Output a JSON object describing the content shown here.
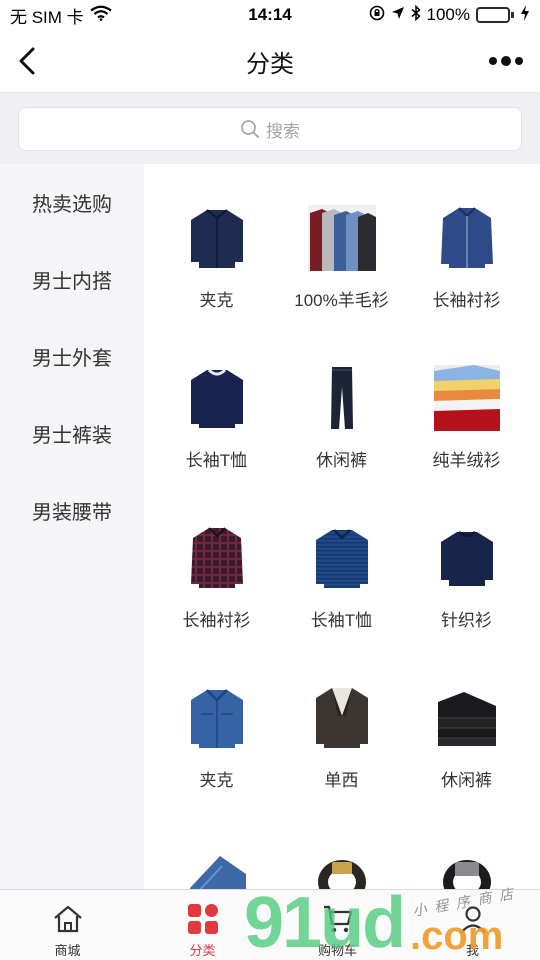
{
  "status_bar": {
    "carrier": "无 SIM 卡",
    "time": "14:14",
    "battery_percent": "100%",
    "battery_level": 1.0,
    "icons": [
      "wifi-icon",
      "orientation-lock-icon",
      "location-icon",
      "bluetooth-icon",
      "battery-icon",
      "charging-icon"
    ]
  },
  "navbar": {
    "title": "分类",
    "back_icon": "chevron-left-icon",
    "more_icon": "more-dots-icon"
  },
  "search": {
    "placeholder": "搜索",
    "icon": "search-icon"
  },
  "sidebar": {
    "items": [
      {
        "label": "热卖选购"
      },
      {
        "label": "男士内搭"
      },
      {
        "label": "男士外套"
      },
      {
        "label": "男士裤装"
      },
      {
        "label": "男装腰带"
      }
    ]
  },
  "products": [
    {
      "label": "夹克",
      "icon": "navy-jacket-image"
    },
    {
      "label": "100%羊毛衫",
      "icon": "wool-sweaters-image"
    },
    {
      "label": "长袖衬衫",
      "icon": "blue-shirt-image"
    },
    {
      "label": "长袖T恤",
      "icon": "navy-longsleeve-tee-image"
    },
    {
      "label": "休闲裤",
      "icon": "navy-trousers-image"
    },
    {
      "label": "纯羊绒衫",
      "icon": "cashmere-stack-image"
    },
    {
      "label": "长袖衬衫",
      "icon": "plaid-shirt-image"
    },
    {
      "label": "长袖T恤",
      "icon": "striped-tee-image"
    },
    {
      "label": "针织衫",
      "icon": "knit-sweater-image"
    },
    {
      "label": "夹克",
      "icon": "denim-jacket-image"
    },
    {
      "label": "单西",
      "icon": "blazer-image"
    },
    {
      "label": "休闲裤",
      "icon": "folded-trousers-image"
    }
  ],
  "tabbar": {
    "items": [
      {
        "label": "商城",
        "icon": "home-icon"
      },
      {
        "label": "分类",
        "icon": "category-icon"
      },
      {
        "label": "购物车",
        "icon": "cart-icon"
      },
      {
        "label": "我",
        "icon": "user-icon"
      }
    ],
    "active_index": 1
  },
  "watermark": {
    "big": "91ud",
    "com": ".com",
    "small": "小 程 序 商 店"
  },
  "colors": {
    "accent": "#e0393e",
    "sidebar_bg": "#f5f5f7",
    "search_band_bg": "#efeff4",
    "battery_green": "#4cd964"
  }
}
